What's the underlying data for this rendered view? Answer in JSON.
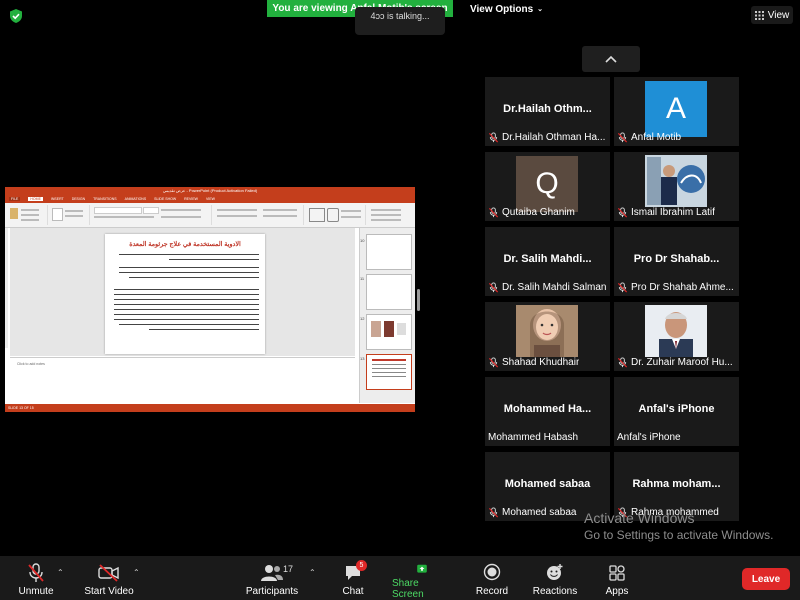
{
  "top": {
    "banner": "You are viewing Anfal Motib's screen",
    "view_options": "View Options",
    "talking": "4ɔɔ is talking...",
    "view_button": "View"
  },
  "shared_screen": {
    "title_bar": "عرض تقديمي - PowerPoint (Product Activation Failed)",
    "ribbon_tabs": [
      "FILE",
      "HOME",
      "INSERT",
      "DESIGN",
      "TRANSITIONS",
      "ANIMATIONS",
      "SLIDE SHOW",
      "REVIEW",
      "VIEW"
    ],
    "slide_title": "الادوية المستخدمة في علاج جرثومة المعدة",
    "notes_placeholder": "Click to add notes",
    "status_bar": "SLIDE 13 OF 15",
    "thumb_numbers": [
      "10",
      "11",
      "12",
      "13"
    ]
  },
  "gallery": {
    "tiles": [
      {
        "big": "Dr.Hailah Othm...",
        "label": "Dr.Hailah Othman Ha...",
        "kind": "name"
      },
      {
        "big": "A",
        "label": "Anfal Motib",
        "kind": "letter",
        "color": "#1f8fd6"
      },
      {
        "big": "Q",
        "label": "Qutaiba Ghanim",
        "kind": "letter",
        "color": "#5a4a3f"
      },
      {
        "big": "",
        "label": "Ismail Ibrahim Latif",
        "kind": "photo-logo"
      },
      {
        "big": "Dr. Salih Mahdi...",
        "label": "Dr. Salih Mahdi Salman",
        "kind": "name"
      },
      {
        "big": "Pro Dr Shahab...",
        "label": "Pro Dr Shahab Ahme...",
        "kind": "name"
      },
      {
        "big": "",
        "label": "Shahad Khudhair",
        "kind": "photo-woman"
      },
      {
        "big": "",
        "label": "Dr. Zuhair Maroof Hu...",
        "kind": "photo-man"
      },
      {
        "big": "Mohammed Ha...",
        "label": "Mohammed Habash",
        "kind": "name",
        "muted": false
      },
      {
        "big": "Anfal's iPhone",
        "label": "Anfal's iPhone",
        "kind": "name"
      },
      {
        "big": "Mohamed sabaa",
        "label": "Mohamed sabaa",
        "kind": "name"
      },
      {
        "big": "Rahma moham...",
        "label": "Rahma mohammed",
        "kind": "name"
      }
    ]
  },
  "watermark": {
    "line1": "Activate Windows",
    "line2": "Go to Settings to activate Windows."
  },
  "toolbar": {
    "unmute": "Unmute",
    "start_video": "Start Video",
    "participants": "Participants",
    "participants_count": "17",
    "chat": "Chat",
    "chat_badge": "5",
    "share_screen": "Share Screen",
    "record": "Record",
    "reactions": "Reactions",
    "apps": "Apps",
    "leave": "Leave"
  },
  "colors": {
    "share_green": "#22b03e",
    "leave_red": "#e02828",
    "powerpoint_red": "#c43e1c"
  }
}
